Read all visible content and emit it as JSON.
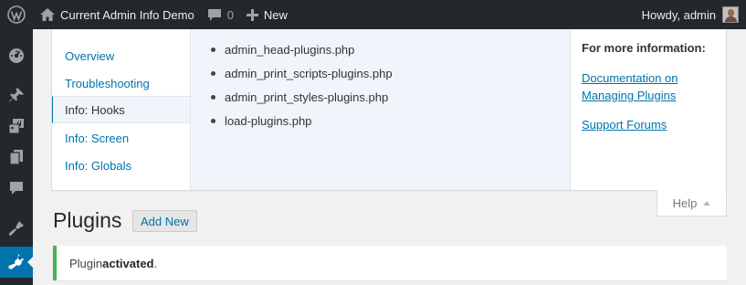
{
  "adminbar": {
    "site_name": "Current Admin Info Demo",
    "comments_count": "0",
    "new_label": "New",
    "howdy": "Howdy, admin"
  },
  "sidebar": {
    "items": [
      {
        "icon": "dashboard-icon"
      },
      {
        "icon": "pin-icon"
      },
      {
        "icon": "media-icon"
      },
      {
        "icon": "pages-icon"
      },
      {
        "icon": "comments-icon"
      },
      {
        "icon": "appearance-icon"
      },
      {
        "icon": "plugins-icon",
        "active": true
      }
    ],
    "accent_color": "#0073aa"
  },
  "help": {
    "tabs": [
      {
        "label": "Overview"
      },
      {
        "label": "Troubleshooting"
      },
      {
        "label": "Info: Hooks",
        "active": true
      },
      {
        "label": "Info: Screen"
      },
      {
        "label": "Info: Globals"
      }
    ],
    "hooks": [
      "admin_head-plugins.php",
      "admin_print_scripts-plugins.php",
      "admin_print_styles-plugins.php",
      "load-plugins.php"
    ],
    "sidebar_title": "For more information:",
    "link_docs": "Documentation on Managing Plugins",
    "link_forums": "Support Forums",
    "toggle_label": "Help"
  },
  "page": {
    "title": "Plugins",
    "add_new": "Add New"
  },
  "notice": {
    "prefix": "Plugin ",
    "emphasis": "activated",
    "suffix": ".",
    "color": "#46b450"
  }
}
